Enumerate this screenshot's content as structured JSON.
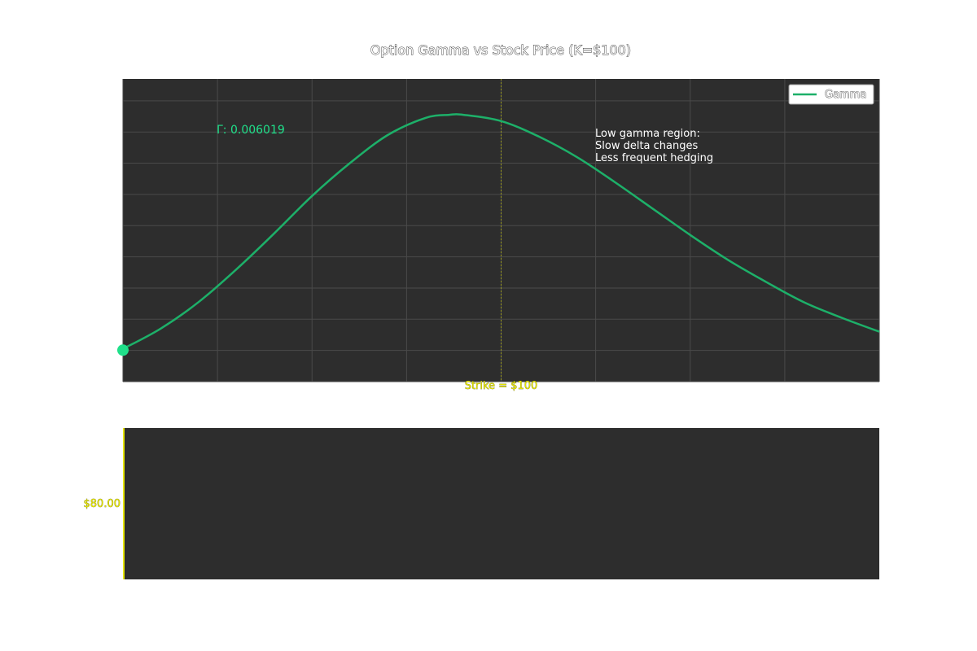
{
  "chart_data": {
    "type": "line",
    "title": "Option Gamma vs Stock Price (K=$100)",
    "x_range": [
      80,
      120
    ],
    "y_range": [
      0.004,
      0.0234
    ],
    "grid": true,
    "legend": {
      "placement": "top-right",
      "entries": [
        "Gamma"
      ]
    },
    "series": [
      {
        "name": "Gamma",
        "color": "#1db069",
        "x": [
          80,
          82,
          84,
          86,
          88,
          90,
          92,
          94,
          96,
          97.25,
          98,
          100,
          102,
          104,
          106,
          108,
          110,
          112,
          114,
          116,
          118,
          120
        ],
        "y": [
          0.0061,
          0.0074,
          0.0091,
          0.0112,
          0.0135,
          0.0159,
          0.018,
          0.0198,
          0.0209,
          0.0211,
          0.0211,
          0.0207,
          0.0197,
          0.0184,
          0.0168,
          0.0151,
          0.0134,
          0.0118,
          0.0104,
          0.0091,
          0.0081,
          0.0072
        ]
      }
    ],
    "strike": {
      "value": 100,
      "label": "Strike = $100",
      "color": "#e6e600"
    },
    "marker": {
      "x": 80,
      "y": 0.006019,
      "readout": "Γ: 0.006019",
      "color": "#1fe08a"
    },
    "annotation": [
      "Low gamma region:",
      "Slow delta changes",
      "Less frequent hedging"
    ],
    "price_panel": {
      "label": "$80.00",
      "value": 80,
      "color": "#e6e600"
    },
    "colors": {
      "panel_bg": "#2d2d2d",
      "grid": "#4a4a4a",
      "line": "#1db069"
    }
  }
}
